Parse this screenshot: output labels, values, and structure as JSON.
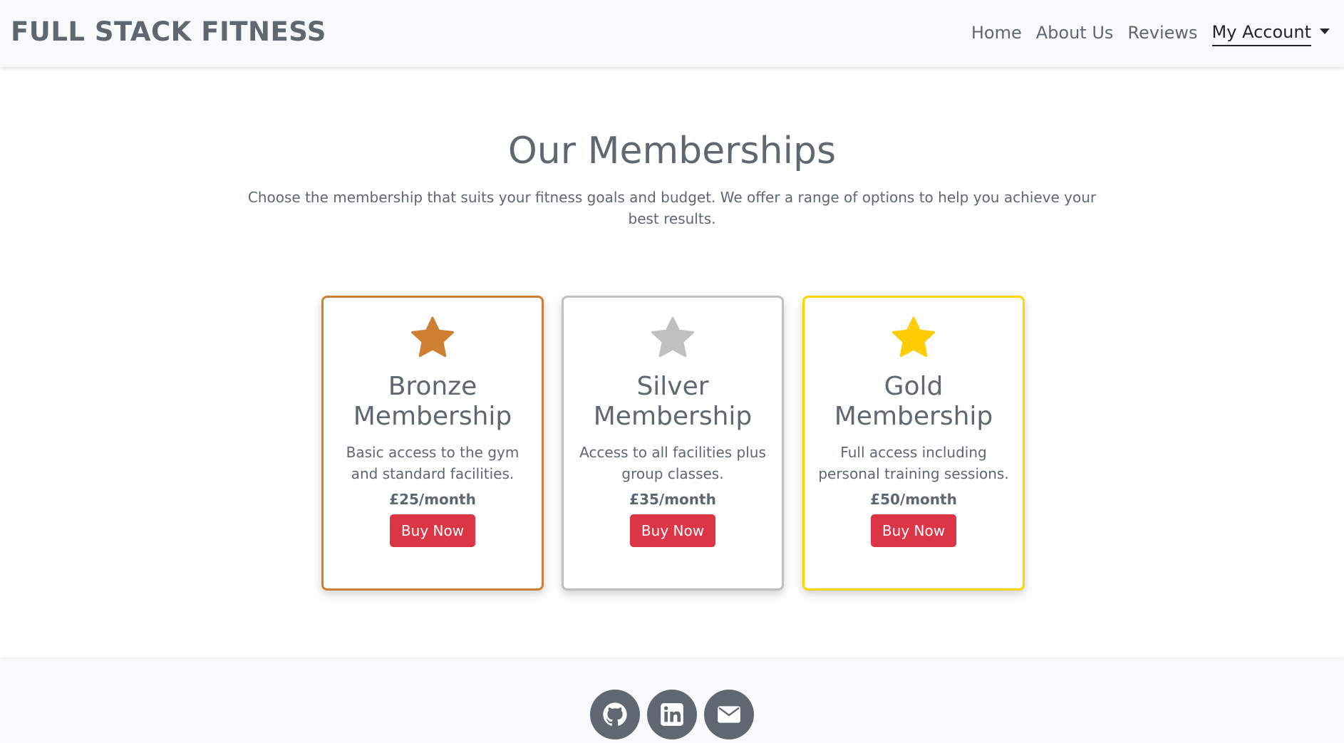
{
  "navbar": {
    "brand": "FULL STACK FITNESS",
    "links": [
      {
        "label": "Home"
      },
      {
        "label": "About Us"
      },
      {
        "label": "Reviews"
      }
    ],
    "account_label": "My Account"
  },
  "main": {
    "title": "Our Memberships",
    "intro": "Choose the membership that suits your fitness goals and budget. We offer a range of options to help you achieve your best results."
  },
  "memberships": [
    {
      "tier": "bronze",
      "title": "Bronze Membership",
      "description": "Basic access to the gym and standard facilities.",
      "price": "£25/month",
      "button": "Buy Now",
      "icon": "star-icon",
      "color": "#cd7f32"
    },
    {
      "tier": "silver",
      "title": "Silver Membership",
      "description": "Access to all facilities plus group classes.",
      "price": "£35/month",
      "button": "Buy Now",
      "icon": "star-icon",
      "color": "#c0c0c0"
    },
    {
      "tier": "gold",
      "title": "Gold Membership",
      "description": "Full access including personal training sessions.",
      "price": "£50/month",
      "button": "Buy Now",
      "icon": "star-icon",
      "color": "#ffd700"
    }
  ],
  "footer": {
    "social": [
      {
        "icon": "github-icon"
      },
      {
        "icon": "linkedin-icon"
      },
      {
        "icon": "envelope-icon"
      }
    ]
  },
  "colors": {
    "text": "#5f6770",
    "button": "#dc3545",
    "navbar_bg": "#f8f9fa"
  }
}
